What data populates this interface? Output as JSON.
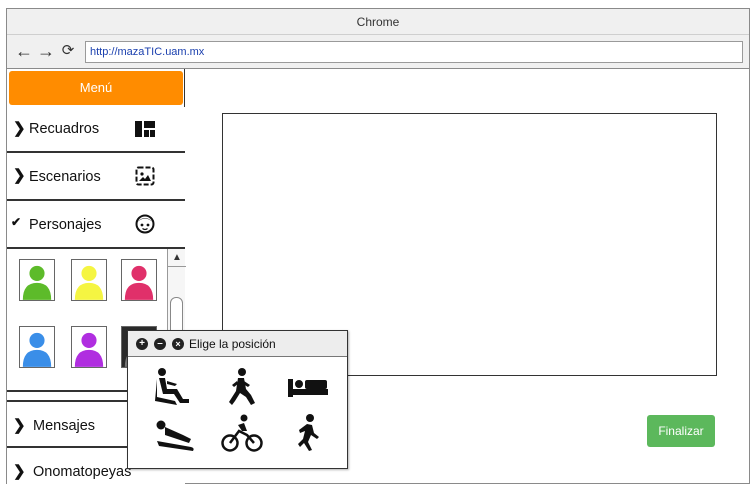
{
  "browser": {
    "title": "Chrome",
    "url": "http://mazaTIC.uam.mx",
    "back_icon": "arrow-left-icon",
    "forward_icon": "arrow-right-icon",
    "reload_icon": "reload-icon"
  },
  "sidebar": {
    "menu_label": "Menú",
    "menu_color": "#ff8c00",
    "items": [
      {
        "label": "Recuadros",
        "icon": "layout-grid-icon",
        "expanded": false
      },
      {
        "label": "Escenarios",
        "icon": "image-frame-icon",
        "expanded": false
      },
      {
        "label": "Personajes",
        "icon": "face-icon",
        "expanded": true
      },
      {
        "label": "Mensajes",
        "expanded": false
      },
      {
        "label": "Onomatopeyas",
        "expanded": false
      }
    ],
    "characters": [
      {
        "color": "#5dbb2a"
      },
      {
        "color": "#f5f542"
      },
      {
        "color": "#e0306a"
      },
      {
        "color": "#3a8ee8"
      },
      {
        "color": "#b02ee0"
      },
      {
        "color": "#2a2a2a"
      }
    ]
  },
  "popup": {
    "title": "Elige la posición",
    "controls": [
      "add-icon",
      "minimize-icon",
      "close-icon"
    ],
    "poses": [
      "sitting-icon",
      "kneeling-icon",
      "lying-bed-icon",
      "sledding-icon",
      "cycling-icon",
      "running-icon"
    ]
  },
  "actions": {
    "finalize_label": "Finalizar",
    "finalize_color": "#5cb85c"
  }
}
